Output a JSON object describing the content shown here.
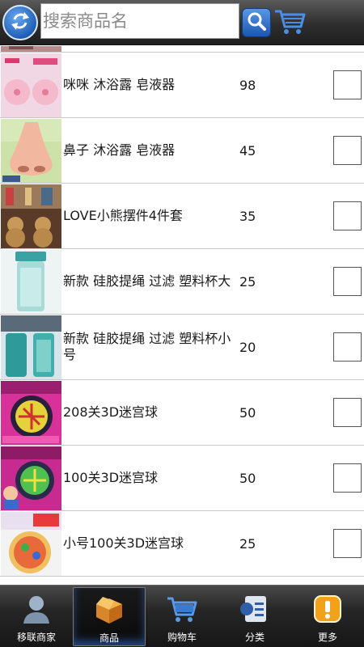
{
  "header": {
    "search_placeholder": "搜索商品名",
    "refresh_icon": "refresh-icon",
    "search_icon": "search-icon",
    "cart_icon": "cart-icon"
  },
  "products": [
    {
      "name": "",
      "price": "",
      "thumb": "partial-product-image"
    },
    {
      "name": "咪咪 沐浴露 皂液器",
      "price": "98",
      "thumb": "pink-soap-dispenser"
    },
    {
      "name": "鼻子 沐浴露 皂液器",
      "price": "45",
      "thumb": "nose-soap-dispenser"
    },
    {
      "name": "LOVE小熊摆件4件套",
      "price": "35",
      "thumb": "bear-figurines"
    },
    {
      "name": "新款 硅胶提绳 过滤 塑料杯大",
      "price": "25",
      "thumb": "teal-bottle-large"
    },
    {
      "name": "新款 硅胶提绳 过滤 塑料杯小号",
      "price": "20",
      "thumb": "teal-bottles-small"
    },
    {
      "name": "208关3D迷宫球",
      "price": "50",
      "thumb": "maze-ball-box"
    },
    {
      "name": "100关3D迷宫球",
      "price": "50",
      "thumb": "maze-ball-box-kid"
    },
    {
      "name": "小号100关3D迷宫球",
      "price": "25",
      "thumb": "small-maze-ball"
    }
  ],
  "tabs": [
    {
      "label": "移联商家",
      "icon": "person-icon",
      "active": false
    },
    {
      "label": "商品",
      "icon": "box-icon",
      "active": true
    },
    {
      "label": "购物车",
      "icon": "shopping-cart-icon",
      "active": false
    },
    {
      "label": "分类",
      "icon": "category-list-icon",
      "active": false
    },
    {
      "label": "更多",
      "icon": "more-alert-icon",
      "active": false
    }
  ],
  "colors": {
    "accent_blue": "#1f5fb8",
    "tab_more_orange": "#f0a21a"
  }
}
